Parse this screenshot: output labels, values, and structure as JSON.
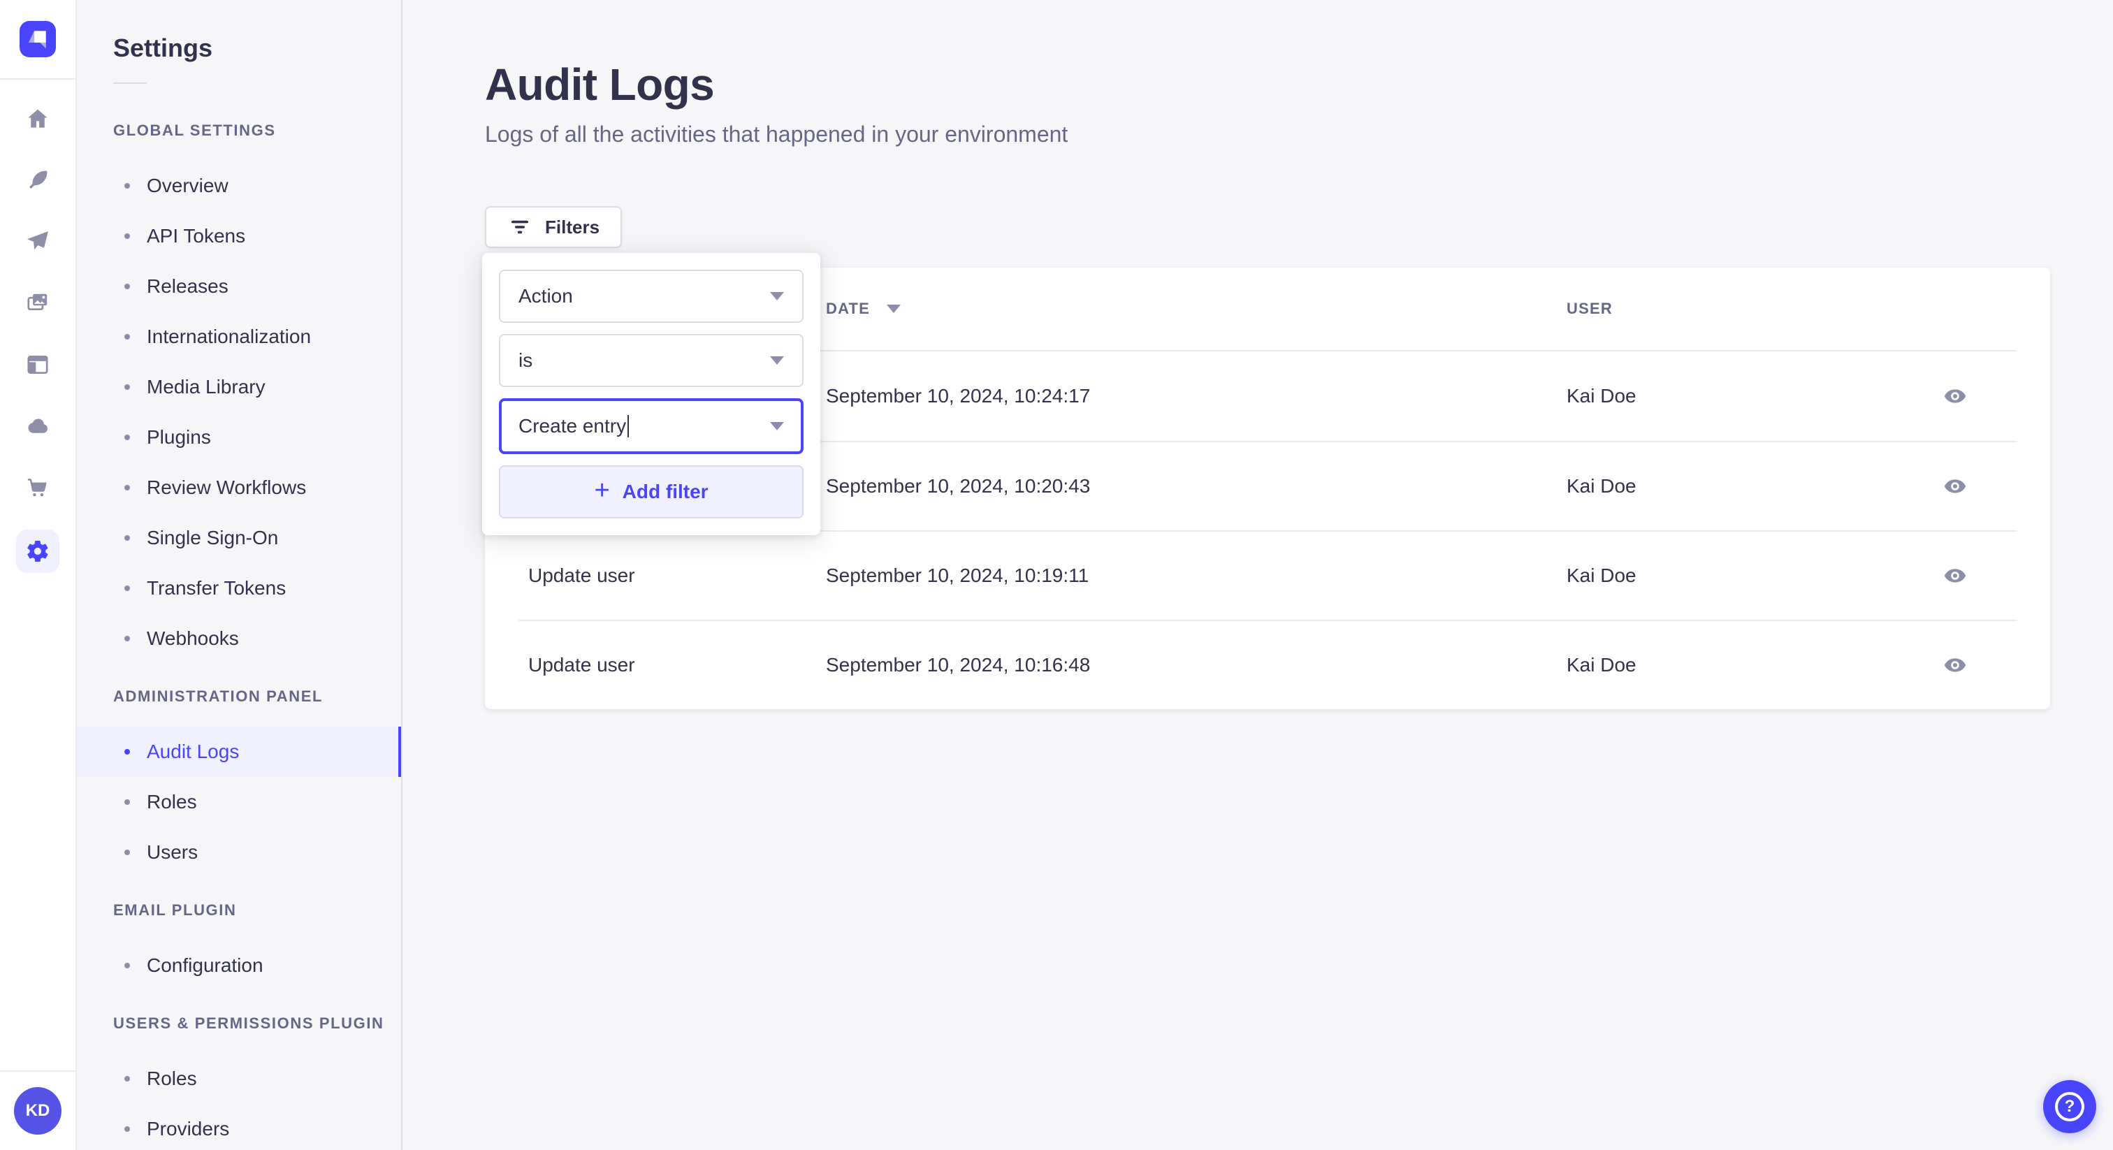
{
  "colors": {
    "primary": "#4945ff",
    "primary_light": "#f0f0ff",
    "text_dark": "#32324d",
    "text_muted": "#666687",
    "icon_gray": "#8e8ea9",
    "background": "#f6f6f9"
  },
  "nav_rail": {
    "items": [
      "home",
      "content-manager",
      "releases",
      "media-library",
      "content-type-builder",
      "cloud",
      "marketplace",
      "settings"
    ],
    "active_item": "settings",
    "user_initials": "KD"
  },
  "sidebar": {
    "title": "Settings",
    "sections": [
      {
        "label": "GLOBAL SETTINGS",
        "items": [
          {
            "label": "Overview"
          },
          {
            "label": "API Tokens"
          },
          {
            "label": "Releases"
          },
          {
            "label": "Internationalization"
          },
          {
            "label": "Media Library"
          },
          {
            "label": "Plugins"
          },
          {
            "label": "Review Workflows"
          },
          {
            "label": "Single Sign-On"
          },
          {
            "label": "Transfer Tokens"
          },
          {
            "label": "Webhooks"
          }
        ]
      },
      {
        "label": "ADMINISTRATION PANEL",
        "items": [
          {
            "label": "Audit Logs",
            "active": true
          },
          {
            "label": "Roles"
          },
          {
            "label": "Users"
          }
        ]
      },
      {
        "label": "EMAIL PLUGIN",
        "items": [
          {
            "label": "Configuration"
          }
        ]
      },
      {
        "label": "USERS & PERMISSIONS PLUGIN",
        "items": [
          {
            "label": "Roles"
          },
          {
            "label": "Providers"
          }
        ]
      }
    ]
  },
  "main": {
    "title": "Audit Logs",
    "subtitle": "Logs of all the activities that happened in your environment",
    "filters_button_label": "Filters",
    "filter_popover": {
      "field_select": "Action",
      "operator_select": "is",
      "value_input": "Create entry",
      "plus": "+",
      "add_filter_label": "Add filter"
    },
    "table": {
      "headers": {
        "action": "",
        "date": "DATE",
        "user": "USER"
      },
      "rows": [
        {
          "action": "",
          "date": "September 10, 2024, 10:24:17",
          "user": "Kai Doe"
        },
        {
          "action": "",
          "date": "September 10, 2024, 10:20:43",
          "user": "Kai Doe"
        },
        {
          "action": "Update user",
          "date": "September 10, 2024, 10:19:11",
          "user": "Kai Doe"
        },
        {
          "action": "Update user",
          "date": "September 10, 2024, 10:16:48",
          "user": "Kai Doe"
        }
      ]
    }
  },
  "help": {
    "question_mark": "?"
  }
}
